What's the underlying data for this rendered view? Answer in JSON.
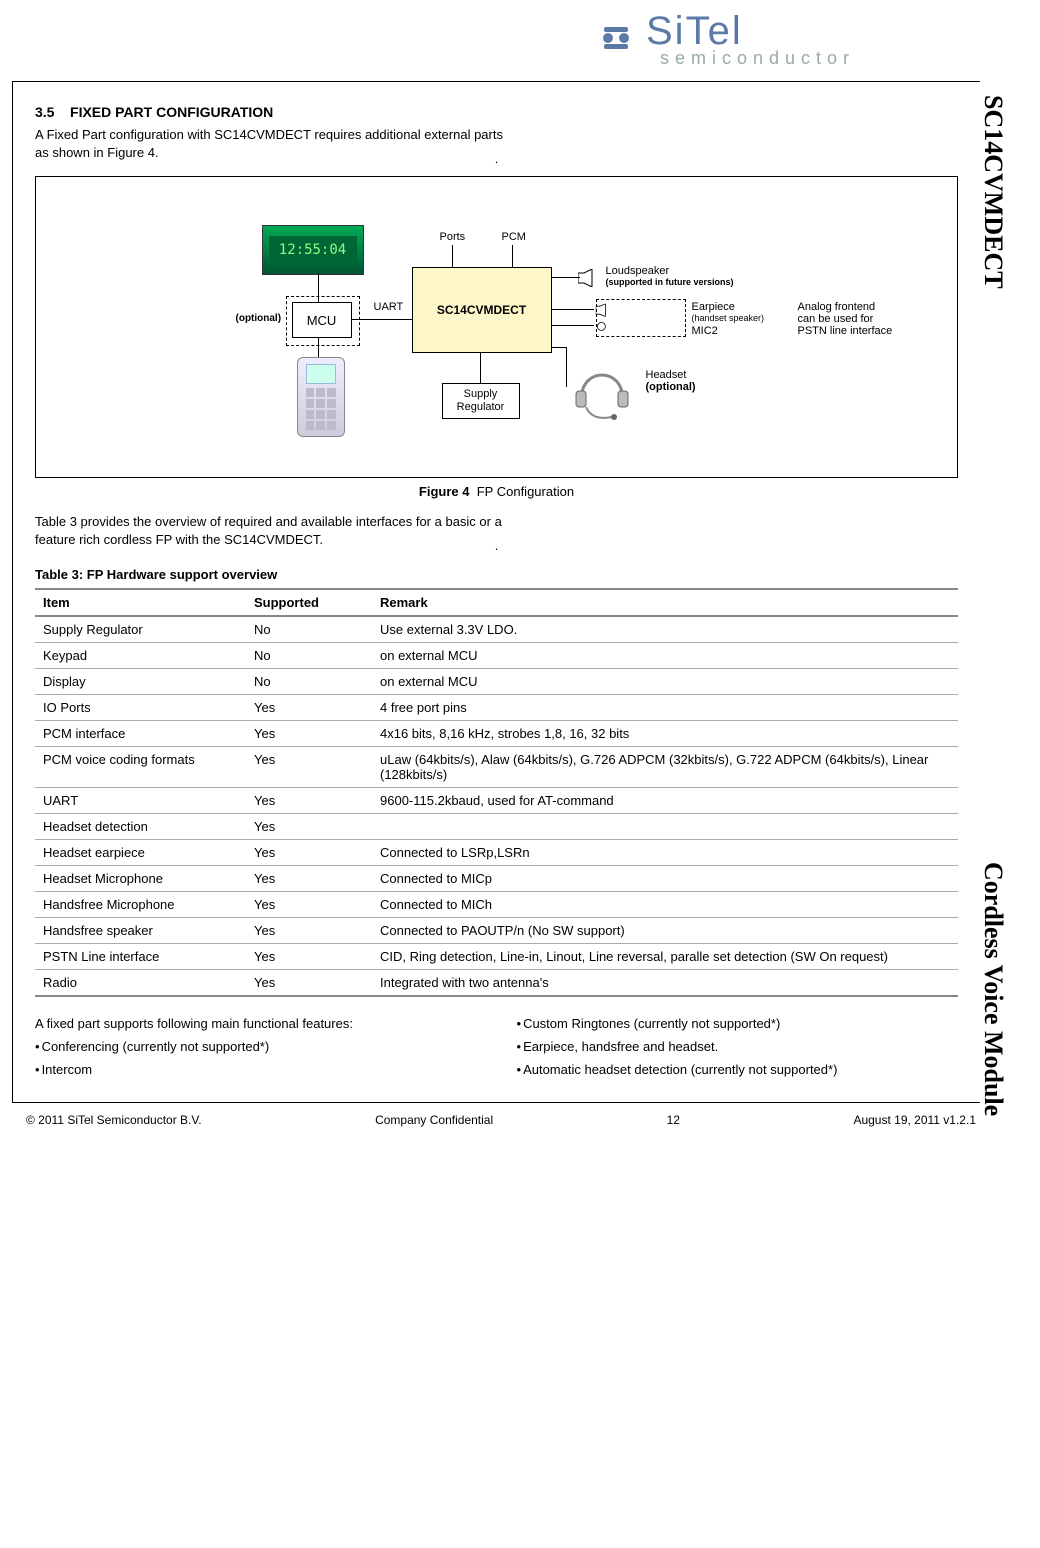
{
  "logo": {
    "brand_top": "SiTel",
    "brand_sub": "semiconductor"
  },
  "side": {
    "top": "SC14CVMDECT",
    "bottom": "Cordless Voice Module"
  },
  "section": {
    "number": "3.5",
    "title": "FIXED PART CONFIGURATION",
    "intro": "A Fixed Part configuration with SC14CVMDECT requires additional external parts as shown in Figure 4."
  },
  "figure": {
    "caption_label": "Figure 4",
    "caption_text": "FP Configuration",
    "labels": {
      "ports": "Ports",
      "pcm": "PCM",
      "uart": "UART",
      "optional": "(optional)",
      "mcu": "MCU",
      "main": "SC14CVMDECT",
      "supply": "Supply Regulator",
      "loudspeaker": "Loudspeaker",
      "loudspeaker_note": "(supported in future versions)",
      "earpiece": "Earpiece",
      "earpiece_note": "(handset speaker)",
      "mic2": "MIC2",
      "afe1": "Analog frontend",
      "afe2": "can be used for",
      "afe3": "PSTN line interface",
      "headset": "Headset",
      "headset_note": "(optional)",
      "lcd_text": "12:55:04"
    }
  },
  "table_intro": "Table 3 provides the overview of required and available interfaces for a basic or a feature rich cordless FP with the SC14CVMDECT.",
  "table": {
    "caption": "Table 3: FP Hardware support overview",
    "headers": {
      "item": "Item",
      "supported": "Supported",
      "remark": "Remark"
    },
    "rows": [
      {
        "item": "Supply Regulator",
        "supported": "No",
        "remark": "Use external 3.3V LDO."
      },
      {
        "item": "Keypad",
        "supported": "No",
        "remark": "on external MCU"
      },
      {
        "item": "Display",
        "supported": "No",
        "remark": "on external MCU"
      },
      {
        "item": "IO Ports",
        "supported": "Yes",
        "remark": "4 free port pins"
      },
      {
        "item": "PCM interface",
        "supported": "Yes",
        "remark": "4x16 bits, 8,16 kHz, strobes 1,8, 16, 32 bits"
      },
      {
        "item": "PCM voice coding formats",
        "supported": "Yes",
        "remark": "uLaw (64kbits/s), Alaw (64kbits/s), G.726 ADPCM (32kbits/s), G.722 ADPCM (64kbits/s), Linear (128kbits/s)"
      },
      {
        "item": "UART",
        "supported": "Yes",
        "remark": "9600-115.2kbaud, used for AT-command"
      },
      {
        "item": "Headset detection",
        "supported": "Yes",
        "remark": ""
      },
      {
        "item": "Headset earpiece",
        "supported": "Yes",
        "remark": "Connected to LSRp,LSRn"
      },
      {
        "item": "Headset Microphone",
        "supported": "Yes",
        "remark": "Connected to MICp"
      },
      {
        "item": "Handsfree Microphone",
        "supported": "Yes",
        "remark": "Connected to MICh"
      },
      {
        "item": "Handsfree speaker",
        "supported": "Yes",
        "remark": "Connected to PAOUTP/n (No SW support)"
      },
      {
        "item": "PSTN Line interface",
        "supported": "Yes",
        "remark": "CID, Ring detection, Line-in, Linout, Line reversal, paralle set detection (SW On request)"
      },
      {
        "item": "Radio",
        "supported": "Yes",
        "remark": "Integrated with two antenna's"
      }
    ]
  },
  "features": {
    "lead": "A fixed part supports following main functional features:",
    "left": [
      "Conferencing (currently not supported*)",
      "Intercom"
    ],
    "right": [
      "Custom Ringtones (currently not supported*)",
      "Earpiece, handsfree and headset.",
      "Automatic headset detection (currently not supported*)"
    ]
  },
  "footer": {
    "copyright": "© 2011 SiTel Semiconductor B.V.",
    "confidential": "Company Confidential",
    "page": "12",
    "date": "August 19, 2011 v1.2.1"
  }
}
